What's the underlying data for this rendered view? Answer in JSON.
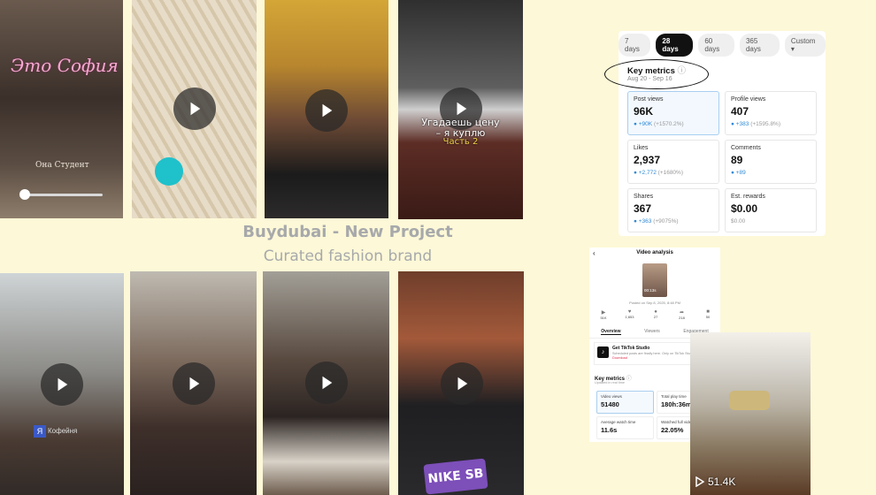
{
  "tiles": [
    {
      "overlay_title": "Это София",
      "overlay_subtitle": "Она Студент"
    },
    {},
    {},
    {
      "caption_line1": "Угадаешь цену",
      "caption_line2": "– я куплю",
      "caption_line3": "Часть 2"
    },
    {
      "badge": "Я",
      "sign_text": "Кофейня"
    },
    {},
    {},
    {
      "shirt_text": "NIKE SB"
    }
  ],
  "brand": {
    "title": "Buydubai - New Project",
    "subtitle": "Curated fashion brand"
  },
  "metrics_panel": {
    "ranges": [
      "7 days",
      "28 days",
      "60 days",
      "365 days",
      "Custom"
    ],
    "selected_range": "28 days",
    "heading": "Key metrics",
    "date_range": "Aug 20 - Sep 16",
    "cards": [
      {
        "label": "Post views",
        "value": "96K",
        "change": "+90K",
        "pct": "(+1570.2%)"
      },
      {
        "label": "Profile views",
        "value": "407",
        "change": "+383",
        "pct": "(+1595.8%)"
      },
      {
        "label": "Likes",
        "value": "2,937",
        "change": "+2,772",
        "pct": "(+1680%)"
      },
      {
        "label": "Comments",
        "value": "89",
        "change": "+89",
        "pct": ""
      },
      {
        "label": "Shares",
        "value": "367",
        "change": "+363",
        "pct": "(+9075%)"
      },
      {
        "label": "Est. rewards",
        "value": "$0.00",
        "change": "$0.00",
        "pct": ""
      }
    ]
  },
  "video_panel": {
    "title": "Video analysis",
    "thumb_time": "00:13s",
    "posted": "Posted on Sep 8, 2025, 8:48 PM",
    "stats": [
      "51K",
      "1,653",
      "27",
      "218",
      "50"
    ],
    "tabs": [
      "Overview",
      "Viewers",
      "Engagement"
    ],
    "promo_title": "Get TikTok Studio",
    "promo_desc": "Scheduled posts are finally here. Only on TikTok Studio",
    "promo_link": "Download",
    "heading": "Key metrics",
    "subheading": "Updated in real time",
    "metrics": [
      {
        "label": "Video views",
        "value": "51480"
      },
      {
        "label": "Total play time",
        "value": "180h:36m:38s"
      },
      {
        "label": "Average watch time",
        "value": "11.6s"
      },
      {
        "label": "Watched full video",
        "value": "22.05%"
      }
    ]
  },
  "bag_photo": {
    "views": "51.4K"
  }
}
